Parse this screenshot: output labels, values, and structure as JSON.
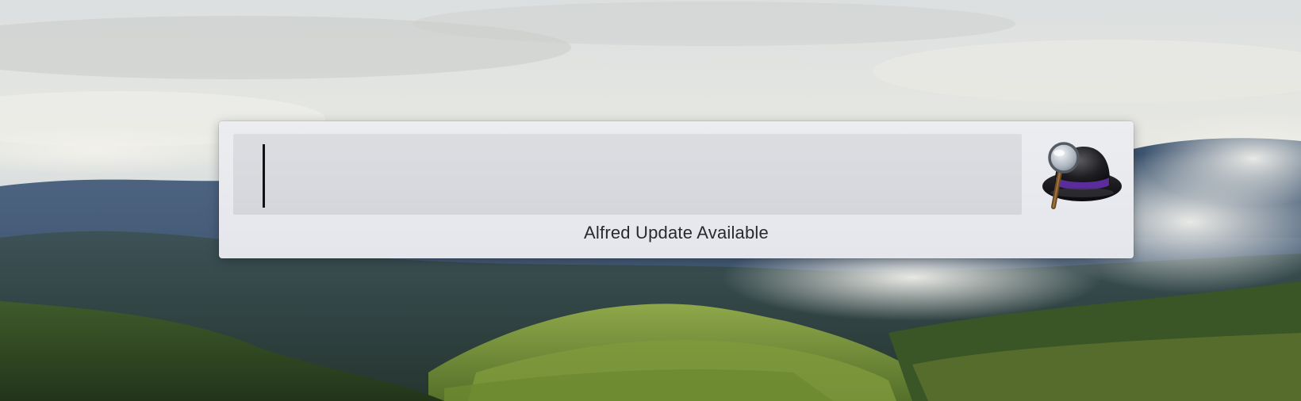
{
  "alfred": {
    "search": {
      "value": "",
      "placeholder": ""
    },
    "logo_icon": "alfred-bowler-hat-with-magnifier",
    "status_text": "Alfred Update Available",
    "colors": {
      "hat_band": "#5b2d9c",
      "window_bg": "#e8e9ed",
      "field_bg": "#d8d9dd"
    }
  },
  "desktop": {
    "wallpaper": "misty-forest-hills"
  }
}
